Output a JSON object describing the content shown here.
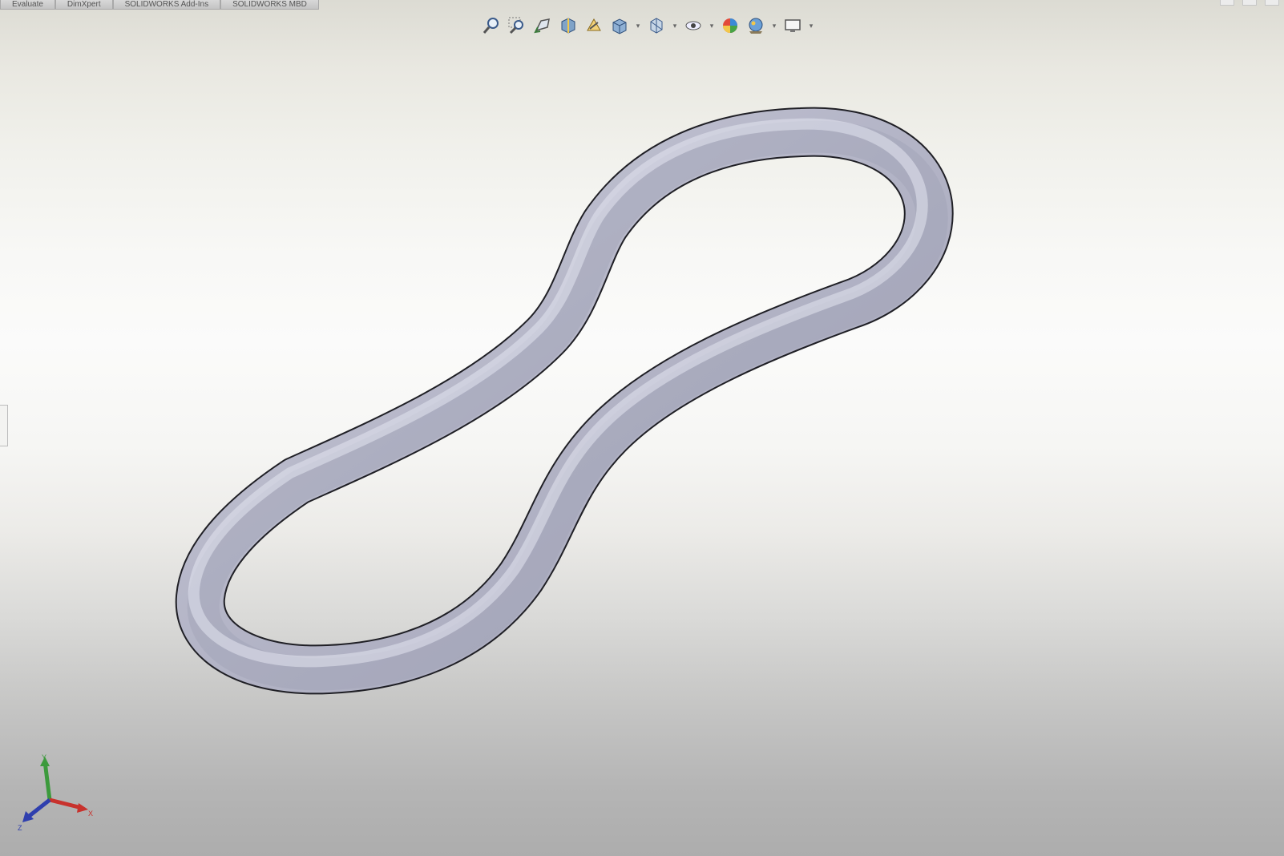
{
  "window": {
    "tabs": [
      "Evaluate",
      "DimXpert",
      "SOLIDWORKS Add-Ins",
      "SOLIDWORKS MBD"
    ]
  },
  "toolbar": {
    "items": [
      {
        "icon": "zoom-to-fit-icon"
      },
      {
        "icon": "zoom-to-area-icon"
      },
      {
        "icon": "previous-view-icon"
      },
      {
        "icon": "section-view-icon"
      },
      {
        "icon": "dynamic-annotation-views-icon"
      },
      {
        "icon": "view-orientation-icon"
      },
      {
        "icon": "display-style-icon"
      },
      {
        "icon": "hide-show-items-icon"
      },
      {
        "icon": "edit-appearance-icon"
      },
      {
        "icon": "apply-scene-icon"
      },
      {
        "icon": "view-settings-icon"
      }
    ]
  },
  "triad": {
    "x_label": "X",
    "y_label": "Y",
    "z_label": "Z"
  },
  "colors": {
    "part": "#b6b7c9",
    "part_highlight": "#e6e7f2",
    "part_outline": "#222228",
    "x_axis": "#c8322d",
    "y_axis": "#3c9a3c",
    "z_axis": "#2f3fae"
  }
}
